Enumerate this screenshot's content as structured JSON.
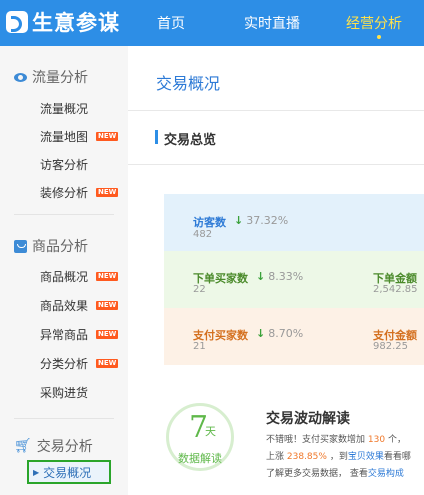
{
  "header": {
    "logo_text": "生意参谋",
    "nav": [
      "首页",
      "实时直播",
      "经营分析"
    ]
  },
  "sidebar": {
    "sections": [
      {
        "title": "流量分析",
        "icon": "eye-icon",
        "items": [
          {
            "label": "流量概况",
            "badge": ""
          },
          {
            "label": "流量地图",
            "badge": "NEW"
          },
          {
            "label": "访客分析",
            "badge": ""
          },
          {
            "label": "装修分析",
            "badge": "NEW"
          }
        ]
      },
      {
        "title": "商品分析",
        "icon": "shopping-bag-icon",
        "items": [
          {
            "label": "商品概况",
            "badge": "NEW"
          },
          {
            "label": "商品效果",
            "badge": "NEW"
          },
          {
            "label": "异常商品",
            "badge": "NEW"
          },
          {
            "label": "分类分析",
            "badge": "NEW"
          },
          {
            "label": "采购进货",
            "badge": ""
          }
        ]
      },
      {
        "title": "交易分析",
        "icon": "cart-icon",
        "items": [
          {
            "label": "交易概况",
            "badge": ""
          }
        ]
      }
    ]
  },
  "main": {
    "page_title": "交易概况",
    "section_title": "交易总览",
    "metrics": {
      "visitors": {
        "label": "访客数",
        "change": "37.32%",
        "value": "482"
      },
      "order_buyers": {
        "label": "下单买家数",
        "change": "8.33%",
        "value": "22"
      },
      "order_amount": {
        "label": "下单金额",
        "value": "2,542.85"
      },
      "pay_buyers": {
        "label": "支付买家数",
        "change": "8.70%",
        "value": "21"
      },
      "pay_amount": {
        "label": "支付金额",
        "value": "982.25"
      }
    },
    "fluctuation": {
      "days": "7",
      "unit": "天",
      "caption": "数据解读",
      "title": "交易波动解读",
      "line1_a": "不错哦！支付买家数增加",
      "line1_num": "130",
      "line1_b": "个，",
      "line2_a": "上涨",
      "line2_pct": "238.85%",
      "line2_b": "，到",
      "line2_link": "宝贝效果",
      "line2_c": "看看哪",
      "line3_a": "了解更多交易数据，",
      "line3_b": "查看",
      "line3_link": "交易构成"
    }
  },
  "colors": {
    "header_bg": "#2d8ee6",
    "active_nav": "#ffe24a",
    "new_badge": "#ff5a1f",
    "decrease_arrow": "#3aa13a"
  }
}
